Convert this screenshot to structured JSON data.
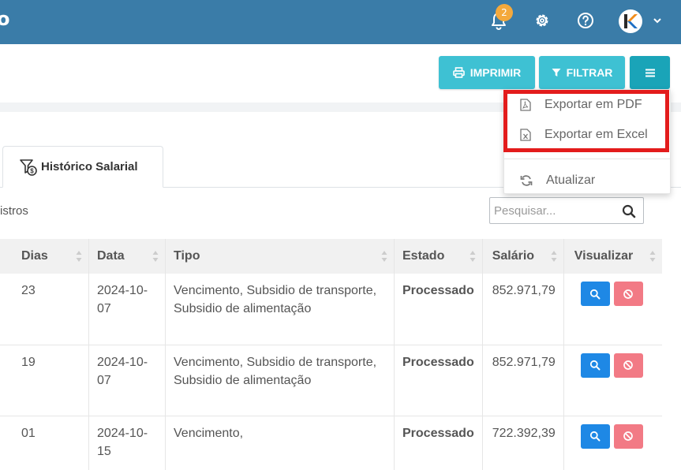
{
  "header": {
    "brand_fragment": "o",
    "notification_count": "2",
    "icons": [
      "bell-icon",
      "gear-icon",
      "help-icon",
      "avatar-k-logo",
      "chevron-down-icon"
    ],
    "colors": {
      "bar": "#3a7ca8",
      "badge": "#f4a93c"
    }
  },
  "toolbar": {
    "print_label": "IMPRIMIR",
    "filter_label": "FILTRAR",
    "menu_icon": "hamburger-icon",
    "colors": {
      "button": "#3ec1d3",
      "menu_button": "#1aa4b8"
    }
  },
  "dropdown": {
    "items": [
      {
        "label": "Exportar em PDF",
        "icon": "pdf-file-icon"
      },
      {
        "label": "Exportar em Excel",
        "icon": "excel-file-icon"
      },
      {
        "label": "Atualizar",
        "icon": "refresh-icon"
      }
    ],
    "highlight_color": "#e31c1c"
  },
  "tab": {
    "label": "Histórico Salarial",
    "icon": "salary-history-icon"
  },
  "records_fragment": "istros",
  "search": {
    "placeholder": "Pesquisar..."
  },
  "table": {
    "columns": [
      "Dias",
      "Data",
      "Tipo",
      "Estado",
      "Salário",
      "Visualizar"
    ],
    "rows": [
      {
        "dias": "23",
        "data": "2024-10-07",
        "tipo": "Vencimento, Subsidio de transporte, Subsidio de alimentação",
        "estado": "Processado",
        "salario": "852.971,79"
      },
      {
        "dias": "19",
        "data": "2024-10-07",
        "tipo": "Vencimento, Subsidio de transporte, Subsidio de alimentação",
        "estado": "Processado",
        "salario": "852.971,79"
      },
      {
        "dias": "01",
        "data": "2024-10-15",
        "tipo": "Vencimento,",
        "estado": "Processado",
        "salario": "722.392,39"
      }
    ],
    "action_icons": [
      "search-icon",
      "cancel-icon"
    ],
    "colors": {
      "estado": "#4a90d9",
      "view": "#1e88e5",
      "cancel": "#f27a85"
    }
  }
}
